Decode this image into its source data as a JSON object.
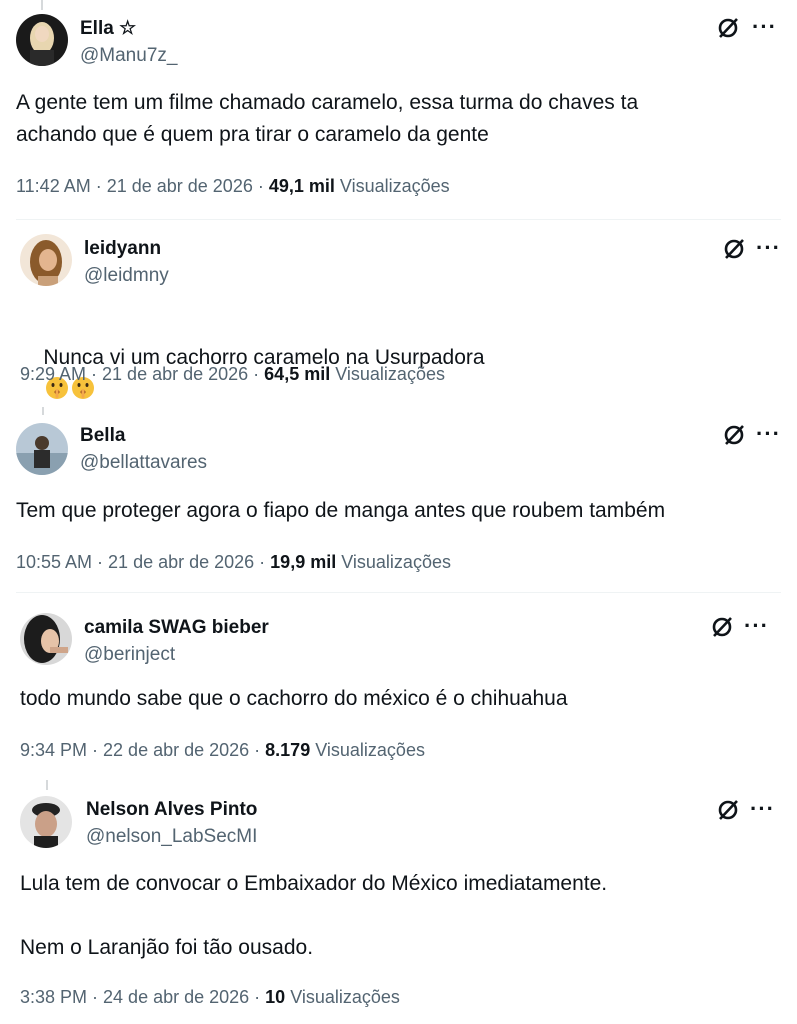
{
  "tweets": [
    {
      "name": "Ella ☆",
      "handle": "@Manu7z_",
      "text": "A gente tem um filme chamado caramelo, essa turma do chaves ta\nachando que é quem pra tirar o caramelo da gente",
      "time": "11:42 AM · 21 de abr de 2026 · ",
      "views": "49,1 mil",
      "views_label": "Visualizações"
    },
    {
      "name": "leidyann",
      "handle": "@leidmny",
      "text": "Nunca vi um cachorro caramelo na Usurpadora",
      "emojis": [
        "shushing-face",
        "shushing-face"
      ],
      "time": "9:29 AM · 21 de abr de 2026 · ",
      "views": "64,5 mil",
      "views_label": "Visualizações"
    },
    {
      "name": "Bella",
      "handle": "@bellattavares",
      "text": "Tem que proteger agora o fiapo de manga antes que roubem também",
      "time": "10:55 AM · 21 de abr de 2026 · ",
      "views": "19,9 mil",
      "views_label": "Visualizações"
    },
    {
      "name": "camila SWAG bieber",
      "handle": "@berinject",
      "text": "todo mundo sabe que o cachorro do méxico é o chihuahua",
      "time": "9:34 PM · 22 de abr de 2026 · ",
      "views": "8.179",
      "views_label": "Visualizações"
    },
    {
      "name": "Nelson Alves Pinto",
      "handle": "@nelson_LabSecMI",
      "text": "Lula tem de convocar o Embaixador do México imediatamente.\n\nNem o Laranjão foi tão ousado.",
      "time": "3:38 PM · 24 de abr de 2026 · ",
      "views": "10",
      "views_label": "Visualizações"
    }
  ],
  "icons": {
    "grok": "grok-icon",
    "more": "more-options-icon",
    "emoji": "shushing-face-emoji"
  },
  "colors": {
    "text": "#0f1419",
    "secondary": "#536471",
    "divider": "#eff3f4"
  }
}
